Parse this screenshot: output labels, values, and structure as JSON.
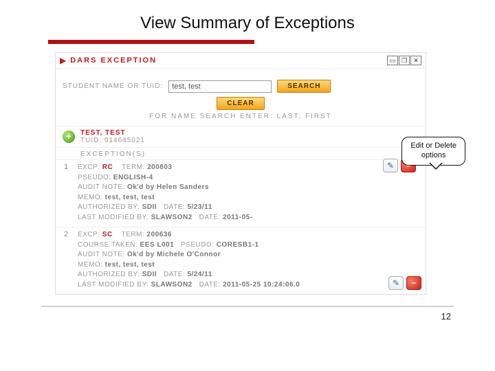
{
  "slide": {
    "title": "View Summary of Exceptions",
    "page_number": "12"
  },
  "panel": {
    "title": "DARS EXCEPTION"
  },
  "search": {
    "label": "STUDENT NAME OR TUID:",
    "value": "test, test",
    "search_btn": "SEARCH",
    "clear_btn": "CLEAR",
    "hint": "FOR NAME SEARCH ENTER: LAST, FIRST"
  },
  "student": {
    "name": "TEST, TEST",
    "tuid_label": "TUID:",
    "tuid": "914645021"
  },
  "exceptions_label": "EXCEPTION(S)",
  "labels": {
    "excp": "EXCP:",
    "term": "TERM:",
    "pseudo": "PSEUDO:",
    "course_taken": "COURSE TAKEN:",
    "audit_note": "AUDIT NOTE:",
    "memo": "MEMO:",
    "authorized_by": "AUTHORIZED BY:",
    "date": "DATE:",
    "last_modified_by": "LAST MODIFIED BY:"
  },
  "exceptions": [
    {
      "n": "1",
      "excp": "RC",
      "term": "200803",
      "pseudo": "ENGLISH-4",
      "audit_note": "Ok'd by Helen Sanders",
      "memo": "test, test, test",
      "auth_by": "SDII",
      "auth_date": "5/23/11",
      "last_by": "SLAWSON2",
      "last_date": "2011-05-"
    },
    {
      "n": "2",
      "excp": "SC",
      "term": "200636",
      "course_taken": "EES L001",
      "pseudo": "CORESB1-1",
      "audit_note": "Ok'd by Michele O'Connor",
      "memo": "test, test, test",
      "auth_by": "SDII",
      "auth_date": "5/24/11",
      "last_by": "SLAWSON2",
      "last_date": "2011-05-25 10:24:06.0"
    }
  ],
  "callout": {
    "line1": "Edit or Delete",
    "line2": "options"
  },
  "win": {
    "min": "▭",
    "max": "❐",
    "close": "✕"
  },
  "icons": {
    "plus": "+",
    "edit": "✎",
    "delete": "−"
  }
}
